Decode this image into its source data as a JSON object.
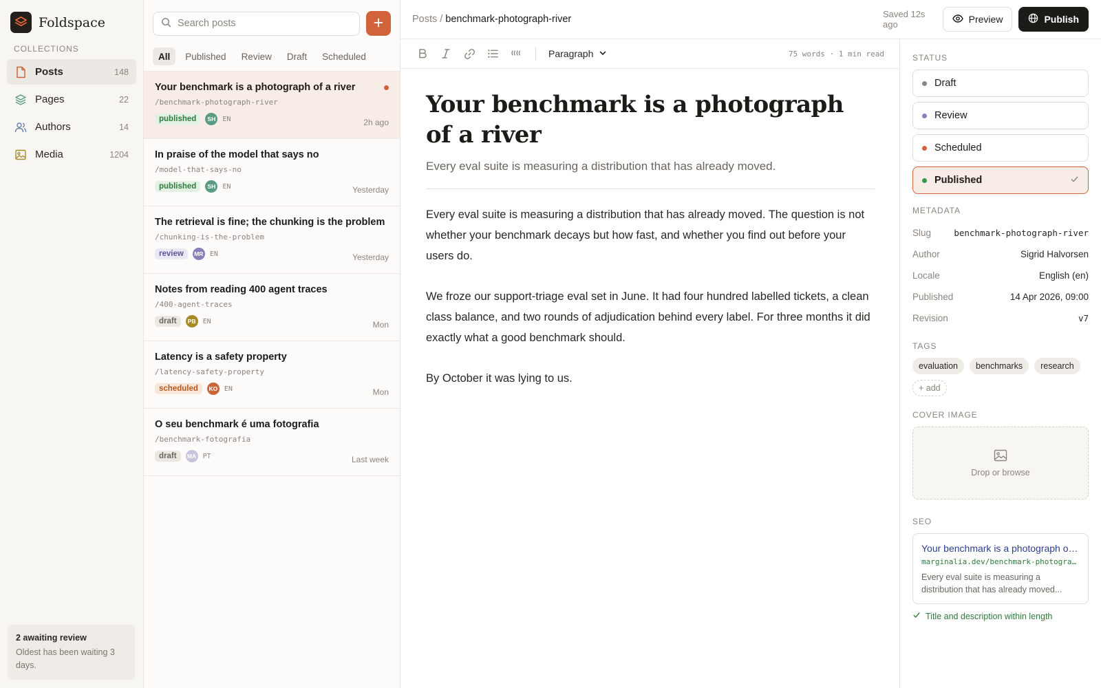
{
  "app": {
    "name": "Foldspace"
  },
  "sidebar": {
    "section_label": "COLLECTIONS",
    "items": [
      {
        "label": "Posts",
        "count": "148",
        "icon": "file-icon",
        "active": true
      },
      {
        "label": "Pages",
        "count": "22",
        "icon": "layers-icon",
        "active": false
      },
      {
        "label": "Authors",
        "count": "14",
        "icon": "users-icon",
        "active": false
      },
      {
        "label": "Media",
        "count": "1204",
        "icon": "image-icon",
        "active": false
      }
    ],
    "review_card": {
      "title": "2 awaiting review",
      "subtitle": "Oldest has been waiting 3 days."
    }
  },
  "postlist": {
    "search_placeholder": "Search posts",
    "filters": [
      "All",
      "Published",
      "Review",
      "Draft",
      "Scheduled"
    ],
    "active_filter": "All",
    "posts": [
      {
        "title": "Your benchmark is a photograph of a river",
        "slug": "/benchmark-photograph-river",
        "status": "published",
        "initials": "SH",
        "avatar_color": "#5a9b83",
        "lang": "EN",
        "time": "2h ago",
        "active": true,
        "unread": true
      },
      {
        "title": "In praise of the model that says no",
        "slug": "/model-that-says-no",
        "status": "published",
        "initials": "SH",
        "avatar_color": "#5a9b83",
        "lang": "EN",
        "time": "Yesterday",
        "active": false,
        "unread": false
      },
      {
        "title": "The retrieval is fine; the chunking is the problem",
        "slug": "/chunking-is-the-problem",
        "status": "review",
        "initials": "MR",
        "avatar_color": "#8a7fb8",
        "lang": "EN",
        "time": "Yesterday",
        "active": false,
        "unread": false
      },
      {
        "title": "Notes from reading 400 agent traces",
        "slug": "/400-agent-traces",
        "status": "draft",
        "initials": "PB",
        "avatar_color": "#a68a2a",
        "lang": "EN",
        "time": "Mon",
        "active": false,
        "unread": false
      },
      {
        "title": "Latency is a safety property",
        "slug": "/latency-safety-property",
        "status": "scheduled",
        "initials": "KO",
        "avatar_color": "#c8663a",
        "lang": "EN",
        "time": "Mon",
        "active": false,
        "unread": false
      },
      {
        "title": "O seu benchmark é uma fotografia",
        "slug": "/benchmark-fotografia",
        "status": "draft",
        "initials": "MA",
        "avatar_color": "#c9c3dc",
        "lang": "PT",
        "time": "Last week",
        "active": false,
        "unread": false
      }
    ]
  },
  "editor": {
    "breadcrumb_root": "Posts",
    "breadcrumb_sep": "/",
    "breadcrumb_current": "benchmark-photograph-river",
    "block_type": "Paragraph",
    "word_count": "75 words · 1 min read",
    "title": "Your benchmark is a photograph of a river",
    "subtitle": "Every eval suite is measuring a distribution that has already moved.",
    "paragraphs": [
      "Every eval suite is measuring a distribution that has already moved. The question is not whether your benchmark decays but how fast, and whether you find out before your users do.",
      "We froze our support-triage eval set in June. It had four hundred labelled tickets, a clean class balance, and two rounds of adjudication behind every label. For three months it did exactly what a good benchmark should.",
      "By October it was lying to us."
    ]
  },
  "topbar": {
    "saved": "Saved 12s ago",
    "preview_label": "Preview",
    "publish_label": "Publish"
  },
  "panel": {
    "status_label": "STATUS",
    "statuses": [
      {
        "label": "Draft",
        "color": "#8a857d",
        "selected": false
      },
      {
        "label": "Review",
        "color": "#8a7fb8",
        "selected": false
      },
      {
        "label": "Scheduled",
        "color": "#d2623a",
        "selected": false
      },
      {
        "label": "Published",
        "color": "#2f9a4a",
        "selected": true
      }
    ],
    "metadata_label": "METADATA",
    "metadata": [
      {
        "key": "Slug",
        "value": "benchmark-photograph-river",
        "mono": true
      },
      {
        "key": "Author",
        "value": "Sigrid Halvorsen",
        "mono": false
      },
      {
        "key": "Locale",
        "value": "English (en)",
        "mono": false
      },
      {
        "key": "Published",
        "value": "14 Apr 2026, 09:00",
        "mono": false
      },
      {
        "key": "Revision",
        "value": "v7",
        "mono": true
      }
    ],
    "tags_label": "TAGS",
    "tags": [
      "evaluation",
      "benchmarks",
      "research"
    ],
    "tag_add": "+ add",
    "cover_label": "COVER IMAGE",
    "cover_drop": "Drop or browse",
    "seo_label": "SEO",
    "seo": {
      "title": "Your benchmark is a photograph of a river",
      "url": "marginalia.dev/benchmark-photograph-river",
      "description": "Every eval suite is measuring a distribution that has already moved...",
      "check": "Title and description within length"
    }
  },
  "colors": {
    "accent": "#d2623a",
    "dark": "#1d1b18",
    "success": "#2f7a3c"
  }
}
